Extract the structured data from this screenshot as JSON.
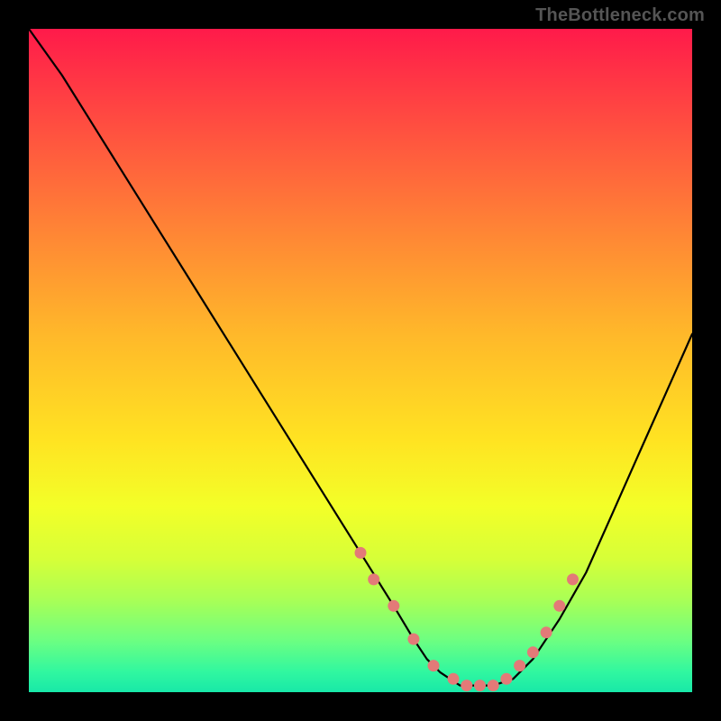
{
  "watermark": "TheBottleneck.com",
  "colors": {
    "background": "#000000",
    "curve_stroke": "#000000",
    "dot_fill": "#e37a78",
    "gradient_top": "#ff1a4a",
    "gradient_bottom": "#18e8a8"
  },
  "chart_data": {
    "type": "line",
    "title": "",
    "xlabel": "",
    "ylabel": "",
    "xlim": [
      0,
      100
    ],
    "ylim": [
      0,
      100
    ],
    "grid": false,
    "legend": false,
    "series": [
      {
        "name": "curve",
        "x": [
          0,
          5,
          10,
          15,
          20,
          25,
          30,
          35,
          40,
          45,
          50,
          55,
          58,
          60,
          62,
          65,
          68,
          70,
          73,
          76,
          80,
          84,
          88,
          92,
          96,
          100
        ],
        "y": [
          100,
          93,
          85,
          77,
          69,
          61,
          53,
          45,
          37,
          29,
          21,
          13,
          8,
          5,
          3,
          1,
          1,
          1,
          2,
          5,
          11,
          18,
          27,
          36,
          45,
          54
        ]
      }
    ],
    "dots": {
      "name": "overlay-points",
      "x": [
        50,
        52,
        55,
        58,
        61,
        64,
        66,
        68,
        70,
        72,
        74,
        76,
        78,
        80,
        82
      ],
      "y": [
        21,
        17,
        13,
        8,
        4,
        2,
        1,
        1,
        1,
        2,
        4,
        6,
        9,
        13,
        17
      ]
    }
  }
}
